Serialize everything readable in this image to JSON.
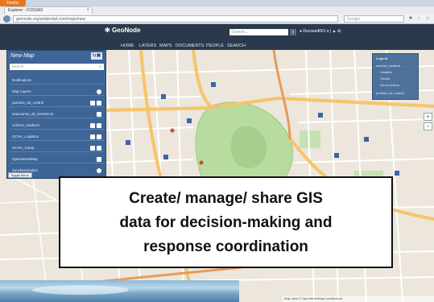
{
  "browser": {
    "app_button": "Firefox",
    "tab_title": "Explorer - FOSSAS",
    "url": "geonode.org/ambiental.com/maps/new",
    "search_placeholder": "Google"
  },
  "geonode": {
    "logo": "GeoNode",
    "search_placeholder": "Search...",
    "user_label": "Docseed001",
    "nav": [
      "HOME",
      "LAYERS",
      "MAPS",
      "DOCUMENTS",
      "PEOPLE",
      "SEARCH"
    ]
  },
  "panel": {
    "title": "New Map",
    "search_placeholder": "Search",
    "layers": [
      {
        "label": "Notifications"
      },
      {
        "label": "Map Layers"
      },
      {
        "label": "puestos_de_control"
      },
      {
        "label": "estaciones_de_bomberos"
      },
      {
        "label": "centros_medicos"
      },
      {
        "label": "OCHA_Logistics"
      },
      {
        "label": "OCHA_Camp"
      },
      {
        "label": "OpenStreetMap"
      },
      {
        "label": "Synchronization"
      }
    ],
    "toggle_menu": "Toggle Menu"
  },
  "legend": {
    "title": "Legend",
    "items": [
      "centros_medicos",
      "Hospital",
      "Clinica",
      "Otros centros",
      "puestos_de_control"
    ]
  },
  "caption": {
    "line1": "Create/ manage/ share  GIS",
    "line2": "data for decision-making and",
    "line3": "response coordination"
  },
  "map_controls": {
    "zoom_in": "+",
    "zoom_out": "−"
  },
  "attribution": "Map data © OpenStreetMap contributors",
  "colors": {
    "header": "#2a3a4c",
    "panel": "#3d6596",
    "park": "#b8dca0",
    "major_road": "#f7c46a"
  }
}
